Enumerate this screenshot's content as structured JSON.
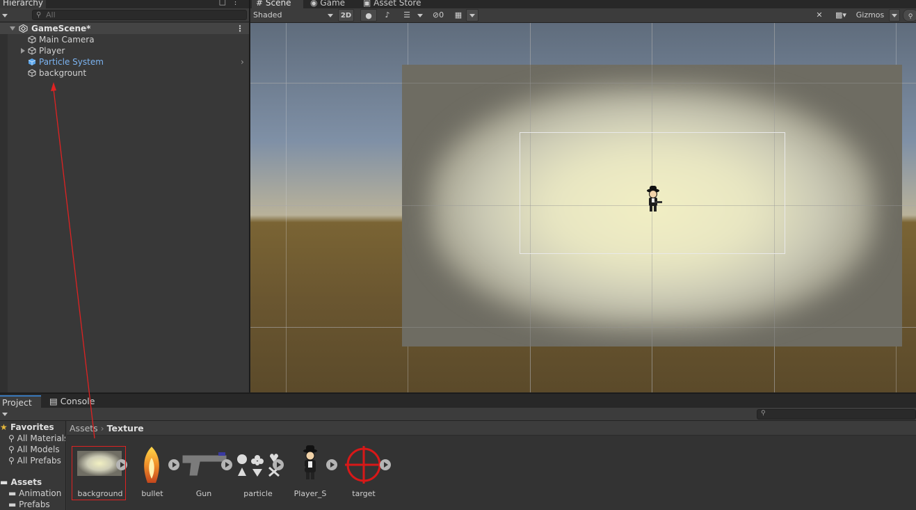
{
  "hierarchy": {
    "tab_label": "Hierarchy",
    "search_placeholder": "All",
    "scene_name": "GameScene*",
    "items": [
      {
        "label": "Main Camera"
      },
      {
        "label": "Player"
      },
      {
        "label": "Particle System"
      },
      {
        "label": "backgrount"
      }
    ]
  },
  "scene_view": {
    "tabs": [
      {
        "label": "Scene"
      },
      {
        "label": "Game"
      },
      {
        "label": "Asset Store"
      }
    ],
    "shading_mode": "Shaded",
    "mode_2d_label": "2D",
    "hidden_count": "0",
    "gizmos_label": "Gizmos"
  },
  "project": {
    "tabs": [
      {
        "label": "Project"
      },
      {
        "label": "Console"
      }
    ],
    "favorites_title": "Favorites",
    "favorites": [
      {
        "label": "All Materials"
      },
      {
        "label": "All Models"
      },
      {
        "label": "All Prefabs"
      }
    ],
    "assets_title": "Assets",
    "folders": [
      {
        "label": "Animation"
      },
      {
        "label": "Prefabs"
      }
    ],
    "breadcrumb": {
      "root": "Assets",
      "current": "Texture"
    },
    "assets": [
      {
        "label": "background",
        "icon": "background-texture-icon"
      },
      {
        "label": "bullet",
        "icon": "flame-bullet-icon"
      },
      {
        "label": "Gun",
        "icon": "pistol-icon"
      },
      {
        "label": "particle",
        "icon": "particle-shapes-icon"
      },
      {
        "label": "Player_S",
        "icon": "player-sprite-icon"
      },
      {
        "label": "target",
        "icon": "crosshair-icon"
      }
    ]
  },
  "colors": {
    "annotation_red": "#e02222",
    "selected_item_blue": "#7cb4f2",
    "active_tab_accent": "#3a79bb"
  }
}
